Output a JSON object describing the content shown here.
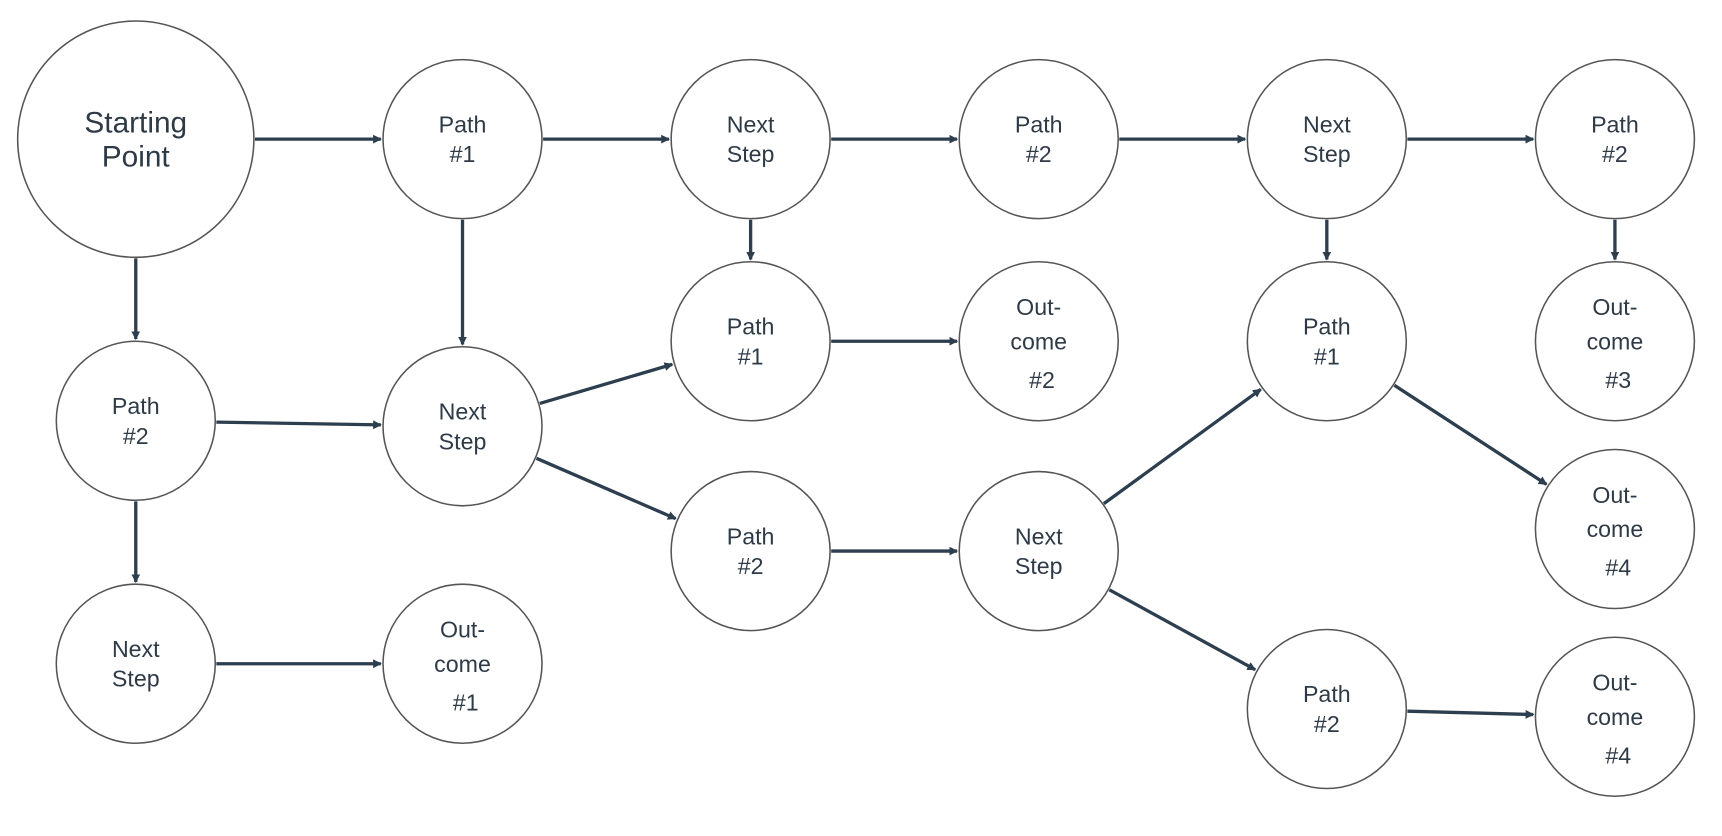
{
  "nodes": [
    {
      "id": "start",
      "lines": [
        "Starting",
        "Point"
      ]
    },
    {
      "id": "a",
      "lines": [
        "Path",
        "#1"
      ]
    },
    {
      "id": "b",
      "lines": [
        "Next",
        "Step"
      ]
    },
    {
      "id": "c",
      "lines": [
        "Path",
        "#2"
      ]
    },
    {
      "id": "d",
      "lines": [
        "Next",
        "Step"
      ]
    },
    {
      "id": "e",
      "lines": [
        "Path",
        "#2"
      ]
    },
    {
      "id": "f",
      "lines": [
        "Path",
        "#2"
      ]
    },
    {
      "id": "g",
      "lines": [
        "Next",
        "Step"
      ]
    },
    {
      "id": "h",
      "lines": [
        "Next",
        "Step"
      ]
    },
    {
      "id": "i",
      "lines": [
        "Out-",
        "come",
        "#1"
      ]
    },
    {
      "id": "j",
      "lines": [
        "Path",
        "#1"
      ]
    },
    {
      "id": "k",
      "lines": [
        "Out-",
        "come",
        "#2"
      ]
    },
    {
      "id": "l",
      "lines": [
        "Path",
        "#2"
      ]
    },
    {
      "id": "m",
      "lines": [
        "Next",
        "Step"
      ]
    },
    {
      "id": "n",
      "lines": [
        "Path",
        "#1"
      ]
    },
    {
      "id": "o",
      "lines": [
        "Out-",
        "come",
        "#3"
      ]
    },
    {
      "id": "p",
      "lines": [
        "Out-",
        "come",
        "#4"
      ]
    },
    {
      "id": "q",
      "lines": [
        "Path",
        "#2"
      ]
    },
    {
      "id": "r",
      "lines": [
        "Out-",
        "come",
        "#4"
      ]
    }
  ],
  "edges": [
    [
      "start",
      "a"
    ],
    [
      "a",
      "b"
    ],
    [
      "b",
      "c"
    ],
    [
      "c",
      "d"
    ],
    [
      "d",
      "e"
    ],
    [
      "start",
      "f"
    ],
    [
      "a",
      "g"
    ],
    [
      "b",
      "j"
    ],
    [
      "d",
      "n"
    ],
    [
      "e",
      "o"
    ],
    [
      "f",
      "g"
    ],
    [
      "f",
      "h"
    ],
    [
      "h",
      "i"
    ],
    [
      "g",
      "j"
    ],
    [
      "g",
      "l"
    ],
    [
      "j",
      "k"
    ],
    [
      "l",
      "m"
    ],
    [
      "m",
      "n"
    ],
    [
      "m",
      "q"
    ],
    [
      "n",
      "p"
    ],
    [
      "q",
      "r"
    ]
  ],
  "colors": {
    "edge": "#2d3e4e",
    "node_stroke": "#555555",
    "text": "#2e3a46"
  }
}
